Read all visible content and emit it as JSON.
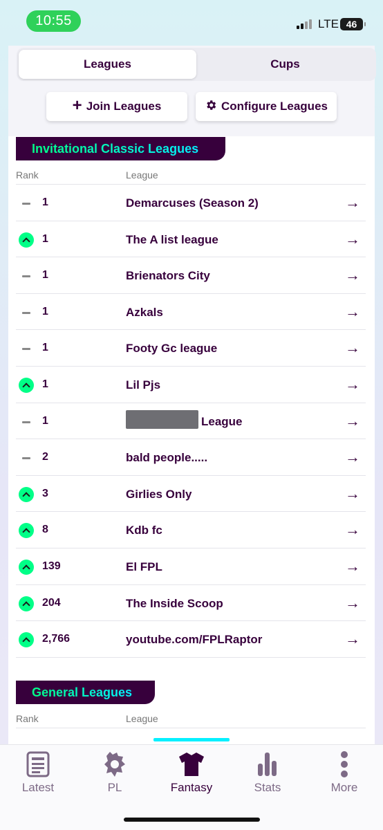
{
  "status_bar": {
    "time": "10:55",
    "network": "LTE",
    "battery": "46"
  },
  "segmented": {
    "tabs": [
      "Leagues",
      "Cups"
    ],
    "active": "Leagues"
  },
  "actions": {
    "join": "Join Leagues",
    "configure": "Configure Leagues"
  },
  "invitational": {
    "title": "Invitational Classic Leagues",
    "col_rank": "Rank",
    "col_league": "League",
    "rows": [
      {
        "movement": "same",
        "rank": "1",
        "name": "Demarcuses (Season 2)"
      },
      {
        "movement": "up",
        "rank": "1",
        "name": "The A list league"
      },
      {
        "movement": "same",
        "rank": "1",
        "name": "Brienators City"
      },
      {
        "movement": "same",
        "rank": "1",
        "name": "Azkals"
      },
      {
        "movement": "same",
        "rank": "1",
        "name": "Footy Gc league"
      },
      {
        "movement": "up",
        "rank": "1",
        "name": "Lil Pjs"
      },
      {
        "movement": "same",
        "rank": "1",
        "name": "League",
        "redacted": true
      },
      {
        "movement": "same",
        "rank": "2",
        "name": "bald people....."
      },
      {
        "movement": "up",
        "rank": "3",
        "name": "Girlies Only"
      },
      {
        "movement": "up",
        "rank": "8",
        "name": "Kdb fc"
      },
      {
        "movement": "up",
        "rank": "139",
        "name": "El FPL"
      },
      {
        "movement": "up",
        "rank": "204",
        "name": "The Inside Scoop"
      },
      {
        "movement": "up",
        "rank": "2,766",
        "name": "youtube.com/FPLRaptor"
      }
    ]
  },
  "general": {
    "title": "General Leagues",
    "col_rank": "Rank",
    "col_league": "League"
  },
  "tab_bar": {
    "items": [
      {
        "label": "Latest",
        "icon": "news-icon"
      },
      {
        "label": "PL",
        "icon": "lion-icon"
      },
      {
        "label": "Fantasy",
        "icon": "shirt-icon",
        "active": true
      },
      {
        "label": "Stats",
        "icon": "bar-chart-icon"
      },
      {
        "label": "More",
        "icon": "more-dots-icon"
      }
    ]
  }
}
